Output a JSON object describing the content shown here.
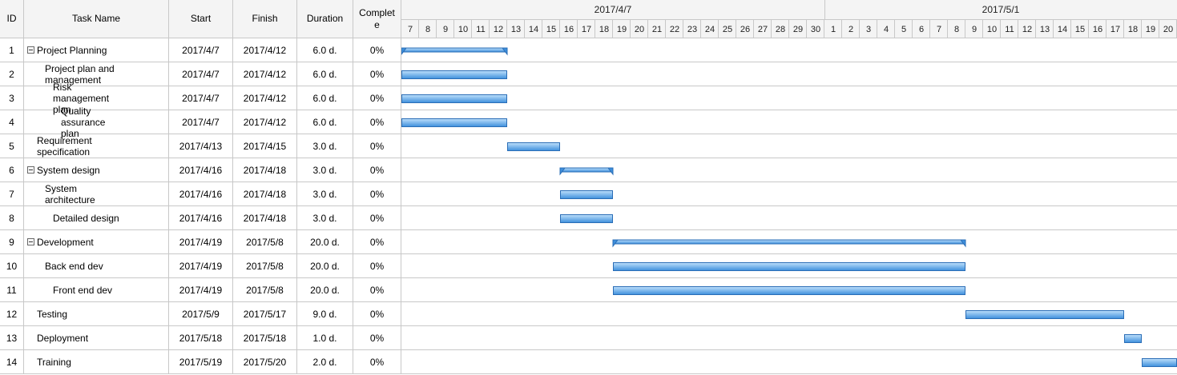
{
  "columns": {
    "id": "ID",
    "name": "Task Name",
    "start": "Start",
    "finish": "Finish",
    "duration": "Duration",
    "complete": "Complete"
  },
  "timeline": {
    "months": [
      {
        "label": "2017/4/7",
        "first_day": 7,
        "last_day": 30
      },
      {
        "label": "2017/5/1",
        "first_day": 1,
        "last_day": 20
      }
    ]
  },
  "colors": {
    "bar_top": "#bfe0fb",
    "bar_bottom": "#3d8fdc",
    "bar_border": "#2a6db6",
    "grid": "#c8c8c8",
    "header_bg": "#f4f4f4"
  },
  "chart_data": {
    "type": "gantt",
    "tasks": [
      {
        "id": "1",
        "name": "Project Planning",
        "start": "2017/4/7",
        "finish": "2017/4/12",
        "duration": "6.0 d.",
        "complete": "0%",
        "level": 0,
        "summary": true
      },
      {
        "id": "2",
        "name": "Project plan and management",
        "start": "2017/4/7",
        "finish": "2017/4/12",
        "duration": "6.0 d.",
        "complete": "0%",
        "level": 1,
        "summary": false
      },
      {
        "id": "3",
        "name": "Risk management  plan",
        "start": "2017/4/7",
        "finish": "2017/4/12",
        "duration": "6.0 d.",
        "complete": "0%",
        "level": 2,
        "summary": false
      },
      {
        "id": "4",
        "name": "Quality assurance plan",
        "start": "2017/4/7",
        "finish": "2017/4/12",
        "duration": "6.0 d.",
        "complete": "0%",
        "level": 3,
        "summary": false
      },
      {
        "id": "5",
        "name": "Requirement specification",
        "start": "2017/4/13",
        "finish": "2017/4/15",
        "duration": "3.0 d.",
        "complete": "0%",
        "level": 0,
        "summary": false
      },
      {
        "id": "6",
        "name": "System design",
        "start": "2017/4/16",
        "finish": "2017/4/18",
        "duration": "3.0 d.",
        "complete": "0%",
        "level": 0,
        "summary": true
      },
      {
        "id": "7",
        "name": "System architecture",
        "start": "2017/4/16",
        "finish": "2017/4/18",
        "duration": "3.0 d.",
        "complete": "0%",
        "level": 1,
        "summary": false
      },
      {
        "id": "8",
        "name": "Detailed design",
        "start": "2017/4/16",
        "finish": "2017/4/18",
        "duration": "3.0 d.",
        "complete": "0%",
        "level": 2,
        "summary": false
      },
      {
        "id": "9",
        "name": "Development",
        "start": "2017/4/19",
        "finish": "2017/5/8",
        "duration": "20.0 d.",
        "complete": "0%",
        "level": 0,
        "summary": true
      },
      {
        "id": "10",
        "name": "Back end dev",
        "start": "2017/4/19",
        "finish": "2017/5/8",
        "duration": "20.0 d.",
        "complete": "0%",
        "level": 1,
        "summary": false
      },
      {
        "id": "11",
        "name": "Front end dev",
        "start": "2017/4/19",
        "finish": "2017/5/8",
        "duration": "20.0 d.",
        "complete": "0%",
        "level": 2,
        "summary": false
      },
      {
        "id": "12",
        "name": "Testing",
        "start": "2017/5/9",
        "finish": "2017/5/17",
        "duration": "9.0 d.",
        "complete": "0%",
        "level": 0,
        "summary": false
      },
      {
        "id": "13",
        "name": "Deployment",
        "start": "2017/5/18",
        "finish": "2017/5/18",
        "duration": "1.0 d.",
        "complete": "0%",
        "level": 0,
        "summary": false
      },
      {
        "id": "14",
        "name": "Training",
        "start": "2017/5/19",
        "finish": "2017/5/20",
        "duration": "2.0 d.",
        "complete": "0%",
        "level": 0,
        "summary": false
      }
    ]
  }
}
